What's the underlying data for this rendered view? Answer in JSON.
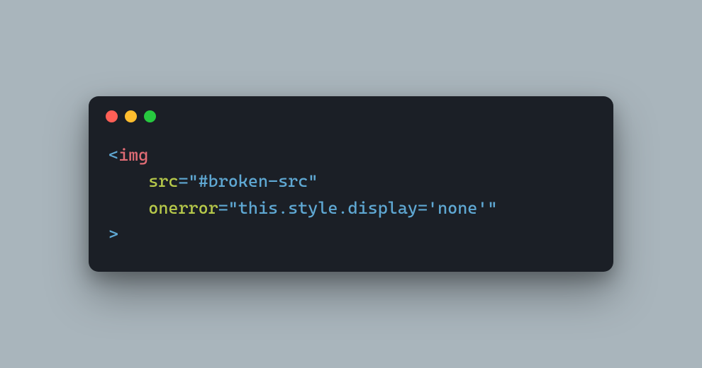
{
  "code": {
    "line1": {
      "open": "<",
      "tag": "img"
    },
    "line2": {
      "indent": "    ",
      "attr": "src",
      "eq": "=",
      "value": "\"#broken-src\""
    },
    "line3": {
      "indent": "    ",
      "attr": "onerror",
      "eq": "=",
      "value": "\"this.style.display='none'\""
    },
    "line4": {
      "close": ">"
    }
  },
  "colors": {
    "background": "#a9b5bc",
    "terminal": "#1b1f26",
    "red": "#ff5f56",
    "yellow": "#ffbd2e",
    "green": "#27c93f"
  }
}
